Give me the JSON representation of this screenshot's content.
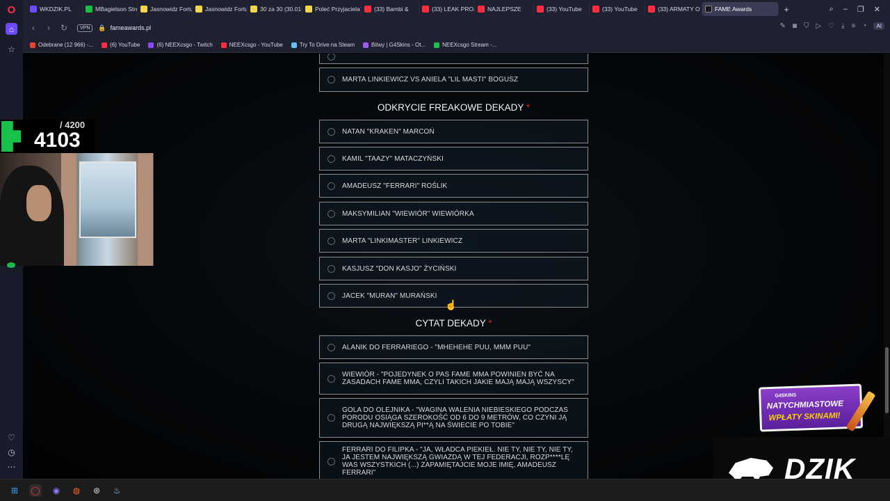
{
  "browser": {
    "tabs": [
      {
        "label": "WKDZIK.PL",
        "color": "#6b4bff"
      },
      {
        "label": "MBagietson Stre",
        "color": "#18c24a"
      },
      {
        "label": "Jasnowidz Fortu",
        "color": "#f2d64b"
      },
      {
        "label": "Jasnowidz Fortu",
        "color": "#f2d64b"
      },
      {
        "label": "30 za 30 (30.01-",
        "color": "#f2d64b"
      },
      {
        "label": "Poleć Przyjaciela",
        "color": "#f2d64b"
      },
      {
        "label": "(33) Bambi &",
        "color": "#ff2d3d"
      },
      {
        "label": "(33) LEAK PROJE",
        "color": "#ff2d3d"
      },
      {
        "label": "NAJLEPSZE",
        "color": "#ff2d3d"
      },
      {
        "label": "(33) YouTube",
        "color": "#ff2d3d"
      },
      {
        "label": "(33) YouTube",
        "color": "#ff2d3d"
      },
      {
        "label": "(33) ARMATY O",
        "color": "#ff2d3d"
      },
      {
        "label": "FAME Awards",
        "color": "#1a1a1a",
        "active": true
      }
    ],
    "url": "fameawards.pl",
    "vpn_label": "VPN",
    "ai_label": "AI",
    "bookmarks": [
      {
        "label": "Odebrane (12 966) -...",
        "color": "#ea4335"
      },
      {
        "label": "(6) YouTube",
        "color": "#ff2d3d"
      },
      {
        "label": "(6) NEEXcsgo - Twitch",
        "color": "#9146ff"
      },
      {
        "label": "NEEXcsgo - YouTube",
        "color": "#ff2d3d"
      },
      {
        "label": "Try To Drive na Steam",
        "color": "#66c0f4"
      },
      {
        "label": "Bitwy | G4Skins - Ot...",
        "color": "#9b59f6"
      },
      {
        "label": "NEEXcsgo Stream -...",
        "color": "#18c24a"
      }
    ]
  },
  "form": {
    "prev_option": "MARTA LINKIEWICZ VS ANIELA \"LIL MASTI\" BOGUSZ",
    "sections": [
      {
        "title": "ODKRYCIE FREAKOWE DEKADY",
        "required_mark": "*",
        "options": [
          "NATAN \"KRAKEN\" MARCOŃ",
          "KAMIL \"TAAZY\" MATACZYŃSKI",
          "AMADEUSZ \"FERRARI\" ROŚLIK",
          "MAKSYMILIAN \"WIEWIÓR\" WIEWIÓRKA",
          "MARTA \"LINKIMASTER\" LINKIEWICZ",
          "KASJUSZ \"DON KASJO\" ŻYCIŃSKI",
          "JACEK \"MURAN\" MURAŃSKI"
        ]
      },
      {
        "title": "CYTAT DEKADY",
        "required_mark": "*",
        "options": [
          "ALANIK DO FERRARIEGO - \"MHEHEHE PUU, MMM PUU\"",
          "WIEWIÓR - \"POJEDYNEK O PAS FAME MMA POWINIEN BYĆ NA ZASADACH FAME MMA, CZYLI TAKICH JAKIE MAJĄ MAJĄ WSZYSCY\"",
          "GOLA DO OLEJNIKA - \"WAGINA WALENIA NIEBIESKIEGO PODCZAS PORODU OSIĄGA SZEROKOŚĆ OD 6 DO 9 METRÓW, CO CZYNI JĄ DRUGĄ NAJWIĘKSZĄ PI**Ą NA ŚWIECIE PO TOBIE\"",
          "FERRARI DO FILIPKA - \"JA, WŁADCA PIEKIEŁ. NIE TY, NIE TY, NIE TY, JA JESTEM NAJWIĘKSZĄ GWIAZDĄ W TEJ FEDERACJI, ROZP****LĘ WAS WSZYSTKICH (...) ZAPAMIĘTAJCIE MOJE IMIĘ, AMADEUSZ FERRARI\""
        ]
      }
    ]
  },
  "overlay": {
    "goal": "/ 4200",
    "current": "4103",
    "promo_brand": "G4SKINS",
    "promo_line1": "NATYCHMIASTOWE",
    "promo_line2": "WPŁATY SKINAMI!",
    "sponsor": "DZIK"
  }
}
